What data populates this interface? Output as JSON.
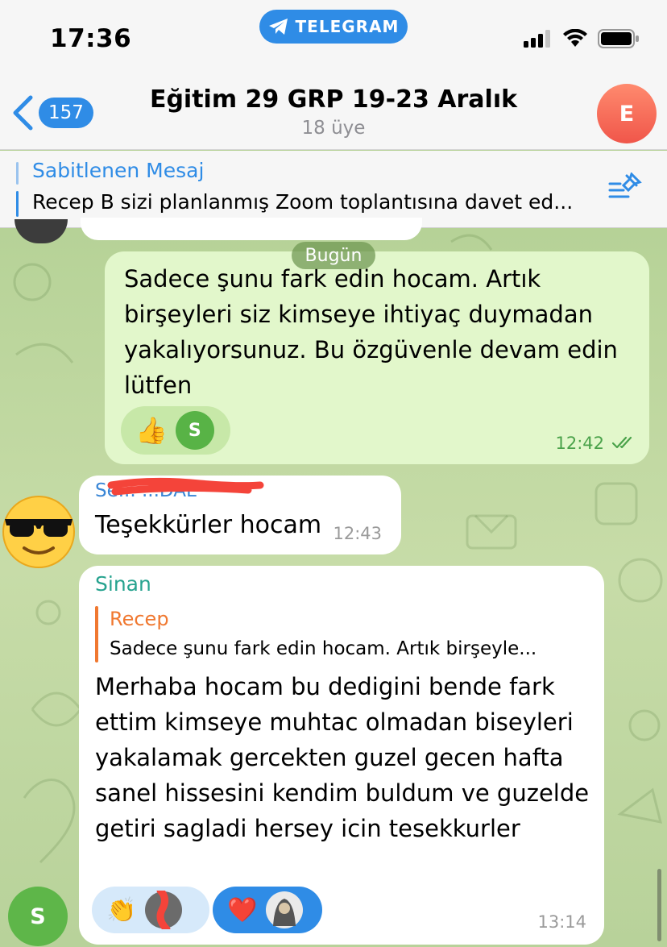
{
  "status_bar": {
    "time": "17:36",
    "app_pill": "TELEGRAM"
  },
  "header": {
    "back_count": "157",
    "title": "Eğitim 29 GRP 19-23 Aralık",
    "subtitle": "18 üye",
    "avatar_letter": "E"
  },
  "pinned": {
    "title": "Sabitlenen Mesaj",
    "text": "Recep B sizi planlanmış Zoom toplantısına davet ed..."
  },
  "date_separator": "Bugün",
  "messages": [
    {
      "direction": "outgoing",
      "text": "Sadece şunu fark edin hocam. Artık birşeyleri siz kimseye ihtiyaç duymadan yakalıyorsunuz. Bu özgüvenle devam edin lütfen",
      "time": "12:42",
      "status": "read",
      "reactions": [
        {
          "emoji": "👍",
          "reactor_letter": "S"
        }
      ]
    },
    {
      "direction": "incoming",
      "sender": "Se... ...DAL",
      "text": "Teşekkürler hocam",
      "time": "12:43",
      "avatar_emoji": "sunglasses-emoji"
    },
    {
      "direction": "incoming",
      "sender": "Sinan",
      "reply": {
        "name": "Recep",
        "text": "Sadece şunu fark edin hocam. Artık birşeyle..."
      },
      "text": "Merhaba hocam bu dedigini bende fark ettim kimseye muhtac olmadan biseyleri yakalamak gercekten guzel gecen hafta sanel hissesini kendim buldum ve guzelde getiri sagladi hersey icin tesekkurler",
      "time": "13:14",
      "avatar_letter": "S",
      "reactions": [
        {
          "emoji": "👏",
          "reactor": "photo"
        },
        {
          "emoji": "❤️",
          "reactor": "photo",
          "selected": true
        }
      ]
    }
  ],
  "colors": {
    "accent": "#2f8ce6",
    "outgoing_bubble": "#e2f7cb",
    "incoming_bubble": "#ffffff",
    "sinan_name": "#27a38f",
    "reply_accent": "#f07830"
  }
}
